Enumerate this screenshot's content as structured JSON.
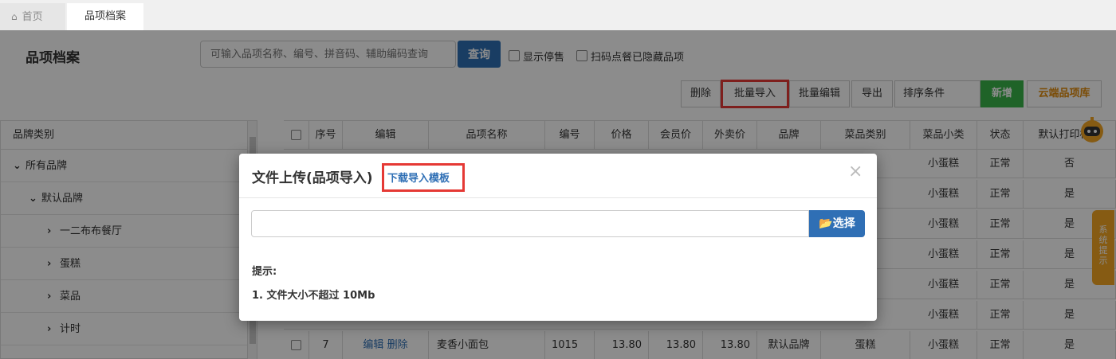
{
  "tabs": {
    "home": "首页",
    "active": "品项档案"
  },
  "page": {
    "title": "品项档案"
  },
  "search": {
    "placeholder": "可输入品项名称、编号、拼音码、辅助编码查询",
    "button": "查询"
  },
  "filters": {
    "show_stopped": "显示停售",
    "hide_scan": "扫码点餐已隐藏品项"
  },
  "toolbar": {
    "delete": "删除",
    "batch_import": "批量导入",
    "batch_edit": "批量编辑",
    "export": "导出",
    "sort": "排序条件",
    "new": "新增",
    "cloud": "云端品项库"
  },
  "sidebar": {
    "header": "品牌类别",
    "items": [
      {
        "label": "所有品牌",
        "chevron": "⌄"
      },
      {
        "label": "默认品牌",
        "chevron": "⌄"
      },
      {
        "label": "一二布布餐厅",
        "chevron": "›"
      },
      {
        "label": "蛋糕",
        "chevron": "›"
      },
      {
        "label": "菜品",
        "chevron": "›"
      },
      {
        "label": "计时",
        "chevron": "›"
      }
    ]
  },
  "table": {
    "headers": [
      "",
      "序号",
      "编辑",
      "品项名称",
      "编号",
      "价格",
      "会员价",
      "外卖价",
      "品牌",
      "菜品类别",
      "菜品小类",
      "状态",
      "默认打印标签"
    ],
    "rows": [
      {
        "sub": "小蛋糕",
        "status": "正常",
        "label": "否"
      },
      {
        "sub": "小蛋糕",
        "status": "正常",
        "label": "是"
      },
      {
        "sub": "小蛋糕",
        "status": "正常",
        "label": "是"
      },
      {
        "sub": "小蛋糕",
        "status": "正常",
        "label": "是"
      },
      {
        "sub": "小蛋糕",
        "status": "正常",
        "label": "是"
      },
      {
        "sub": "小蛋糕",
        "status": "正常",
        "label": "是"
      }
    ],
    "last_row": {
      "no": "7",
      "edit": "编辑",
      "del": "删除",
      "name": "麦香小面包",
      "code": "1015",
      "price": "13.80",
      "member": "13.80",
      "takeout": "13.80",
      "brand": "默认品牌",
      "category": "蛋糕",
      "sub": "小蛋糕",
      "status": "正常",
      "label": "是"
    }
  },
  "side_tab": {
    "label": "系统提示"
  },
  "modal": {
    "title": "文件上传(品项导入)",
    "download": "下载导入模板",
    "close": "×",
    "choose": "选择",
    "tip": "提示:",
    "tip1": "1. 文件大小不超过 10Mb"
  },
  "colors": {
    "primary": "#2f6fb5",
    "green": "#39b54a",
    "orange": "#e08a0a",
    "highlight": "#e53935"
  }
}
